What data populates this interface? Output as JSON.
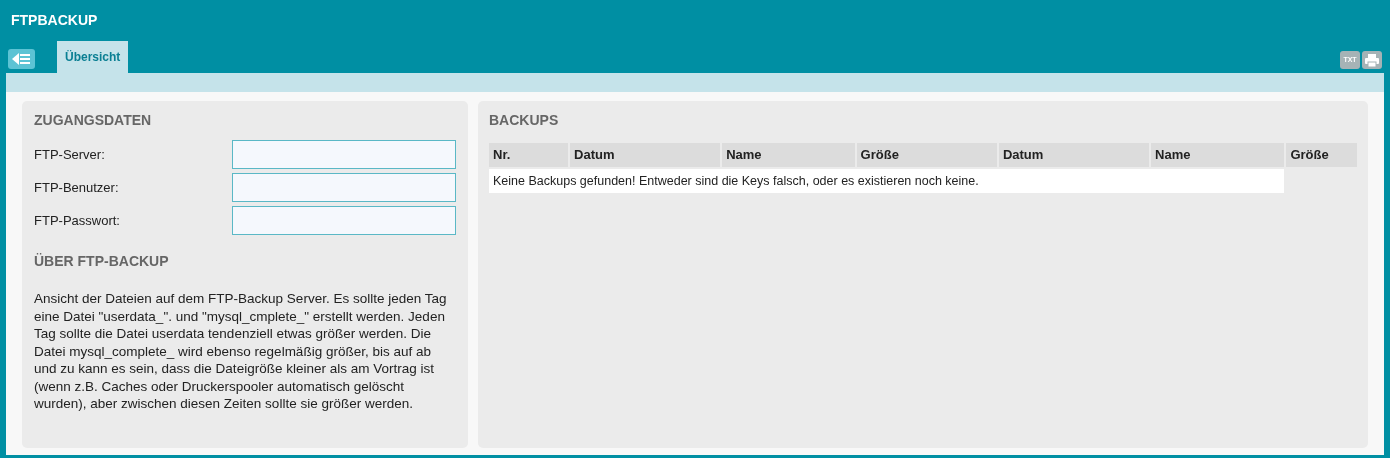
{
  "app": {
    "title": "FTPBACKUP"
  },
  "tabs": [
    {
      "label": "Übersicht",
      "selected": true
    }
  ],
  "toolbar": {
    "txt_button": "TXT"
  },
  "credentials": {
    "heading": "ZUGANGSDATEN",
    "fields": [
      {
        "label": "FTP-Server:"
      },
      {
        "label": "FTP-Benutzer:"
      },
      {
        "label": "FTP-Passwort:"
      }
    ]
  },
  "about": {
    "heading": "ÜBER FTP-BACKUP",
    "text": "Ansicht der Dateien auf dem FTP-Backup Server. Es sollte jeden Tag eine Datei \"userdata_\". und \"mysql_cmplete_\" erstellt werden. Jeden Tag sollte die Datei userdata tendenziell etwas größer werden. Die Datei mysql_complete_ wird ebenso regelmäßig größer, bis auf ab und zu kann es sein, dass die Dateigröße kleiner als am Vortrag ist (wenn z.B. Caches oder Druckerspooler automatisch gelöscht wurden), aber zwischen diesen Zeiten sollte sie größer werden."
  },
  "backups": {
    "heading": "BACKUPS",
    "columns": [
      "Nr.",
      "Datum",
      "Name",
      "Größe",
      "Datum",
      "Name",
      "Größe"
    ],
    "empty_message": "Keine Backups gefunden! Entweder sind die Keys falsch, oder es existieren noch keine."
  }
}
